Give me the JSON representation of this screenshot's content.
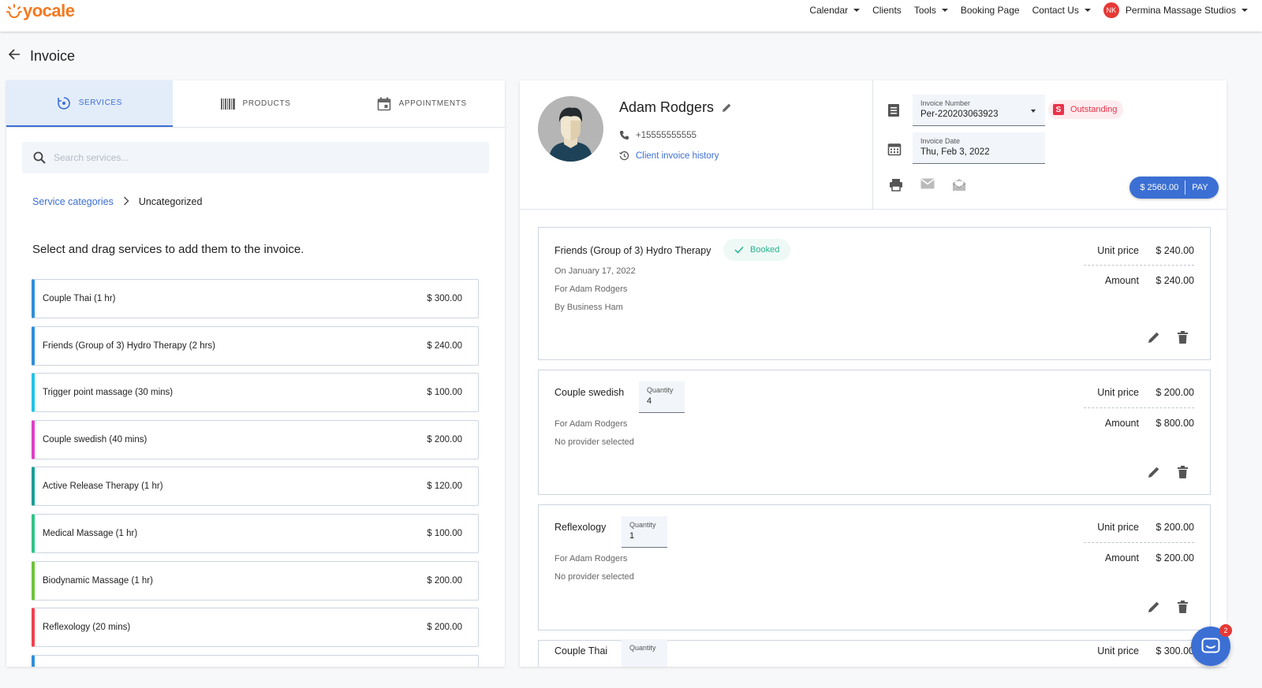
{
  "app": {
    "logo_text": "yocale"
  },
  "nav": {
    "items": [
      {
        "label": "Calendar",
        "dropdown": true
      },
      {
        "label": "Clients",
        "dropdown": false
      },
      {
        "label": "Tools",
        "dropdown": true
      },
      {
        "label": "Booking Page",
        "dropdown": false
      },
      {
        "label": "Contact Us",
        "dropdown": true
      }
    ],
    "account": {
      "initials": "NK",
      "label": "Permina Massage Studios"
    }
  },
  "page": {
    "title": "Invoice"
  },
  "left": {
    "tabs": [
      {
        "label": "SERVICES",
        "icon": "services-icon",
        "active": true
      },
      {
        "label": "PRODUCTS",
        "icon": "barcode-icon",
        "active": false
      },
      {
        "label": "APPOINTMENTS",
        "icon": "calendar-icon",
        "active": false
      }
    ],
    "search": {
      "placeholder": "Search services..."
    },
    "breadcrumb": {
      "root": "Service categories",
      "current": "Uncategorized"
    },
    "instruction": "Select and drag services to add them to the invoice.",
    "services": [
      {
        "name": "Couple Thai (1 hr)",
        "price": "$ 300.00",
        "color": "#2f8fd8"
      },
      {
        "name": "Friends (Group of 3) Hydro Therapy (2 hrs)",
        "price": "$ 240.00",
        "color": "#2f8fd8"
      },
      {
        "name": "Trigger point massage (30 mins)",
        "price": "$ 100.00",
        "color": "#22c4e4"
      },
      {
        "name": "Couple swedish (40 mins)",
        "price": "$ 200.00",
        "color": "#e040c8"
      },
      {
        "name": "Active Release Therapy (1 hr)",
        "price": "$ 120.00",
        "color": "#1a9f97"
      },
      {
        "name": "Medical Massage (1 hr)",
        "price": "$ 100.00",
        "color": "#2fc486"
      },
      {
        "name": "Biodynamic Massage (1 hr)",
        "price": "$ 200.00",
        "color": "#6cc43a"
      },
      {
        "name": "Reflexology (20 mins)",
        "price": "$ 200.00",
        "color": "#f0414f"
      },
      {
        "name": "",
        "price": "",
        "color": "#2f8fd8"
      }
    ]
  },
  "client": {
    "name": "Adam Rodgers",
    "phone": "+15555555555",
    "history_link": "Client invoice history"
  },
  "invoice": {
    "number_label": "Invoice Number",
    "number": "Per-220203063923",
    "date_label": "Invoice Date",
    "date": "Thu, Feb 3, 2022",
    "status_icon": "S",
    "status": "Outstanding",
    "pay_amount": "$ 2560.00",
    "pay_label": "PAY"
  },
  "line_items": [
    {
      "title": "Friends (Group of 3) Hydro Therapy",
      "badge": "Booked",
      "lines": [
        "On January 17, 2022",
        "For Adam Rodgers",
        "By Business Ham"
      ],
      "unit_price_label": "Unit price",
      "unit_price": "$ 240.00",
      "amount_label": "Amount",
      "amount": "$ 240.00"
    },
    {
      "title": "Couple swedish",
      "quantity_label": "Quantity",
      "quantity": "4",
      "lines": [
        "For Adam Rodgers",
        "No provider selected"
      ],
      "unit_price_label": "Unit price",
      "unit_price": "$ 200.00",
      "amount_label": "Amount",
      "amount": "$ 800.00"
    },
    {
      "title": "Reflexology",
      "quantity_label": "Quantity",
      "quantity": "1",
      "lines": [
        "For Adam Rodgers",
        "No provider selected"
      ],
      "unit_price_label": "Unit price",
      "unit_price": "$ 200.00",
      "amount_label": "Amount",
      "amount": "$ 200.00"
    },
    {
      "title": "Couple Thai",
      "quantity_label": "Quantity",
      "unit_price_label": "Unit price",
      "unit_price": "$ 300.00"
    }
  ],
  "chat": {
    "badge": "2"
  },
  "colors": {
    "accent": "#3b6fd4",
    "brand": "#f47920",
    "danger": "#e8334a",
    "success": "#26b28f"
  }
}
